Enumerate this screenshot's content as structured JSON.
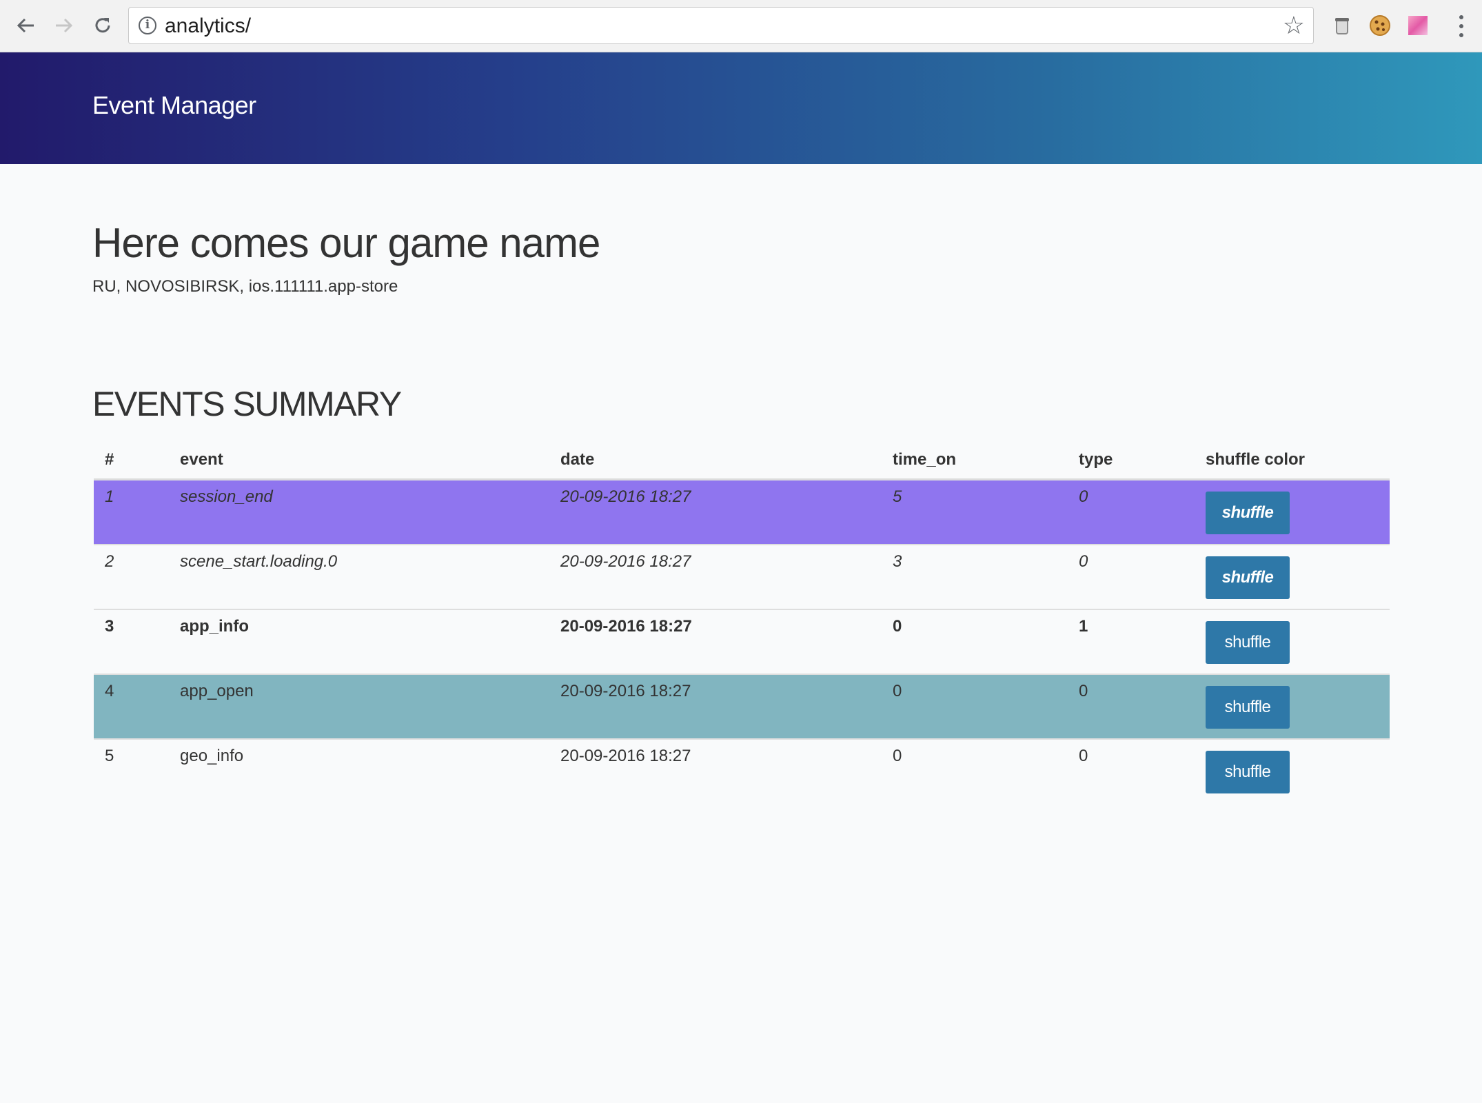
{
  "browser": {
    "url": "analytics/",
    "icons": {
      "back": "back-arrow-icon",
      "forward": "forward-arrow-icon",
      "reload": "reload-icon",
      "info": "info-icon",
      "bookmark": "star-icon",
      "menu": "kebab-menu-icon"
    }
  },
  "header": {
    "title": "Event Manager",
    "gradient_colors": [
      "#221a6b",
      "#286b9f",
      "#2f98bb"
    ]
  },
  "game": {
    "name": "Here comes our game name",
    "meta": "RU, NOVOSIBIRSK, ios.111111.app-store"
  },
  "events": {
    "title": "EVENTS SUMMARY",
    "columns": [
      "#",
      "event",
      "date",
      "time_on",
      "type",
      "shuffle color"
    ],
    "rows": [
      {
        "num": "1",
        "event": "session_end",
        "date": "20-09-2016 18:27",
        "time_on": "5",
        "type": "0",
        "button": "shuffle",
        "bg": "#8f75ef",
        "style": "italic"
      },
      {
        "num": "2",
        "event": "scene_start.loading.0",
        "date": "20-09-2016 18:27",
        "time_on": "3",
        "type": "0",
        "button": "shuffle",
        "bg": "#f9fafb",
        "style": "italic"
      },
      {
        "num": "3",
        "event": "app_info",
        "date": "20-09-2016 18:27",
        "time_on": "0",
        "type": "1",
        "button": "shuffle",
        "bg": "#f9fafb",
        "style": "bold"
      },
      {
        "num": "4",
        "event": "app_open",
        "date": "20-09-2016 18:27",
        "time_on": "0",
        "type": "0",
        "button": "shuffle",
        "bg": "#81b5c0",
        "style": "normal"
      },
      {
        "num": "5",
        "event": "geo_info",
        "date": "20-09-2016 18:27",
        "time_on": "0",
        "type": "0",
        "button": "shuffle",
        "bg": "#f9fafb",
        "style": "normal"
      }
    ],
    "button_color": "#2e78a8"
  }
}
